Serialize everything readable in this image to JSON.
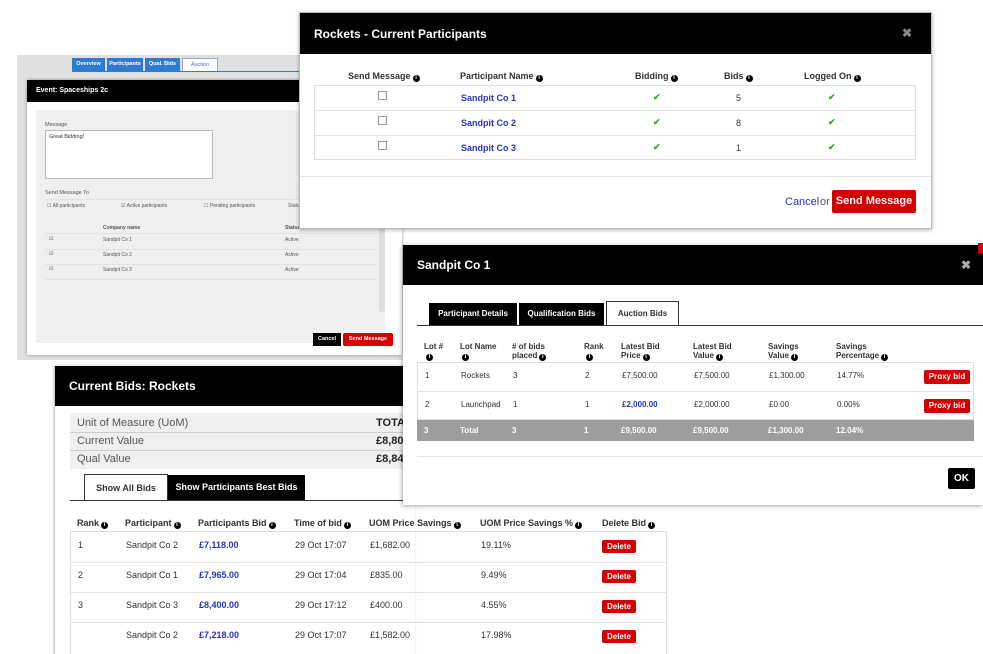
{
  "event_panel": {
    "tabs": [
      "Overview",
      "Participants",
      "Qual. Bids",
      "Auction"
    ],
    "title": "Event: Spaceships 2c",
    "message_label": "Message",
    "message_value": "Great Bidding!",
    "send_to_label": "Send Message To",
    "radios": [
      "All participants",
      "Active participants",
      "Pending participants"
    ],
    "status_partial": "Statu",
    "table_headers": {
      "company": "Company name",
      "status": "Status"
    },
    "rows": [
      {
        "name": "Sandpit Co 1",
        "status": "Active"
      },
      {
        "name": "Sandpit Co 2",
        "status": "Active"
      },
      {
        "name": "Sandpit Co 3",
        "status": "Active"
      }
    ],
    "cancel_label": "Cancel",
    "send_label": "Send Message"
  },
  "rockets_modal": {
    "title": "Rockets - Current Participants",
    "headers": [
      "Send Message",
      "Participant Name",
      "Bidding",
      "Bids",
      "Logged On"
    ],
    "rows": [
      {
        "name": "Sandpit Co 1",
        "bids": "5"
      },
      {
        "name": "Sandpit Co 2",
        "bids": "8"
      },
      {
        "name": "Sandpit Co 3",
        "bids": "1"
      }
    ],
    "cancel_label": "Cancel",
    "or_label": "or",
    "send_label": "Send Message"
  },
  "current_bids": {
    "title": "Current Bids: Rockets",
    "summary": [
      {
        "label": "Unit of Measure (UoM)",
        "value": "TOTA"
      },
      {
        "label": "Current Value",
        "value": "£8,80"
      },
      {
        "label": "Qual Value",
        "value": "£8,84"
      }
    ],
    "tabs": [
      "Show All Bids",
      "Show Participants Best Bids"
    ],
    "headers": [
      "Rank",
      "Participant",
      "Participants Bid",
      "Time of bid",
      "UOM Price Savings",
      "UOM Price Savings %",
      "Delete Bid"
    ],
    "rows": [
      {
        "rank": "1",
        "participant": "Sandpit Co 2",
        "bid": "£7,118.00",
        "time": "29 Oct 17:07",
        "savings": "£1,682.00",
        "pct": "19.11%"
      },
      {
        "rank": "2",
        "participant": "Sandpit Co 1",
        "bid": "£7,965.00",
        "time": "29 Oct 17:04",
        "savings": "£835.00",
        "pct": "9.49%"
      },
      {
        "rank": "3",
        "participant": "Sandpit Co 3",
        "bid": "£8,400.00",
        "time": "29 Oct 17:12",
        "savings": "£400.00",
        "pct": "4.55%"
      },
      {
        "rank": "",
        "participant": "Sandpit Co 2",
        "bid": "£7,218.00",
        "time": "29 Oct 17:07",
        "savings": "£1,582.00",
        "pct": "17.98%"
      }
    ],
    "delete_label": "Delete"
  },
  "sandpit_modal": {
    "title": "Sandpit Co 1",
    "tabs": [
      "Participant Details",
      "Qualification Bids",
      "Auction Bids"
    ],
    "headers": [
      {
        "l1": "Lot #",
        "l2": ""
      },
      {
        "l1": "Lot Name",
        "l2": ""
      },
      {
        "l1": "# of bids",
        "l2": "placed"
      },
      {
        "l1": "Rank",
        "l2": ""
      },
      {
        "l1": "Latest Bid",
        "l2": "Price"
      },
      {
        "l1": "Latest Bid",
        "l2": "Value"
      },
      {
        "l1": "Savings",
        "l2": "Value"
      },
      {
        "l1": "Savings",
        "l2": "Percentage"
      }
    ],
    "rows": [
      {
        "lot": "1",
        "name": "Rockets",
        "bids": "3",
        "rank": "2",
        "price": "£7,500.00",
        "value": "£7,500.00",
        "savings": "£1,300.00",
        "pct": "14.77%"
      },
      {
        "lot": "2",
        "name": "Launchpad",
        "bids": "1",
        "rank": "1",
        "price": "£2,000.00",
        "value": "£2,000.00",
        "savings": "£0.00",
        "pct": "0.00%"
      }
    ],
    "total": {
      "lot": "3",
      "name": "Total",
      "bids": "3",
      "rank": "1",
      "price": "£9,500.00",
      "value": "£9,500.00",
      "savings": "£1,300.00",
      "pct": "12.04%"
    },
    "proxy_label": "Proxy bid",
    "ok_label": "OK"
  }
}
